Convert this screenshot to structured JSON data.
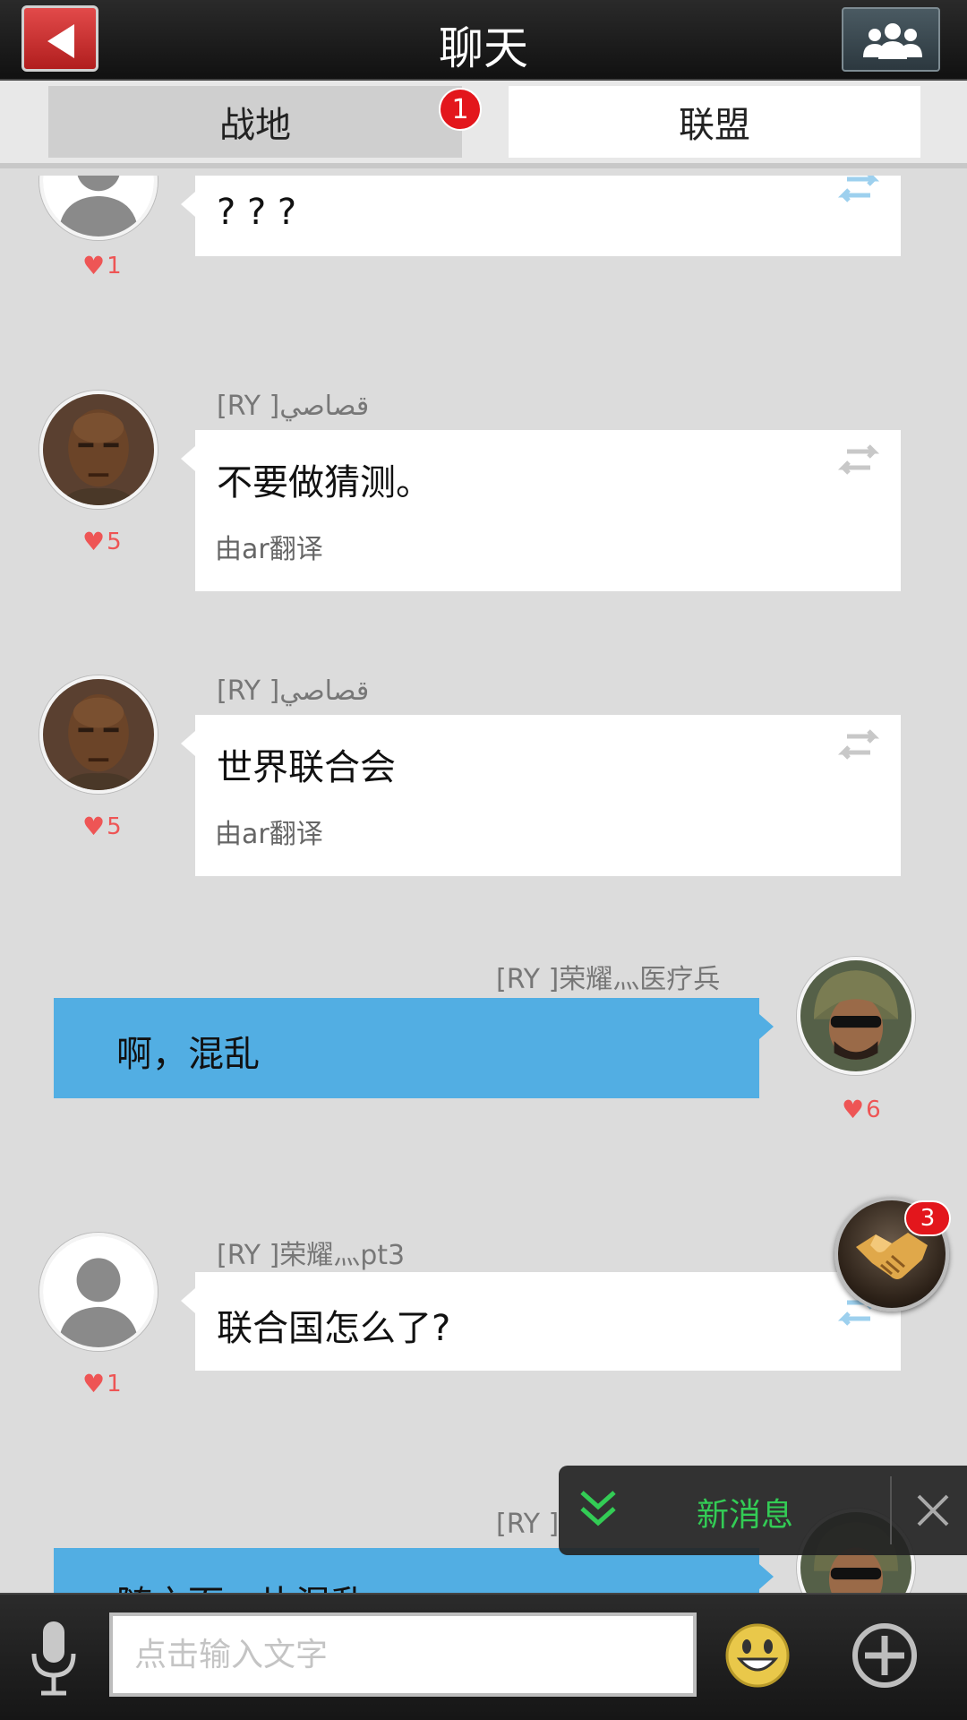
{
  "header": {
    "title": "聊天"
  },
  "tabs": [
    {
      "label": "战地",
      "badge": "1"
    },
    {
      "label": "联盟"
    }
  ],
  "messages": [
    {
      "text": "? ? ?",
      "likes": "1"
    },
    {
      "sender": "[RY ]قصاصي",
      "text": "不要做猜测。",
      "note": "由ar翻译",
      "likes": "5"
    },
    {
      "sender": "[RY ]قصاصي",
      "text": "世界联合会",
      "note": "由ar翻译",
      "likes": "5"
    },
    {
      "sender": "[RY ]荣耀灬医疗兵",
      "text": "啊，混乱",
      "likes": "6"
    },
    {
      "sender": "[RY ]荣耀灬pt3",
      "text": "联合国怎么了?",
      "likes": "1"
    },
    {
      "sender": "[RY ]",
      "text": "随之而一片混乱"
    }
  ],
  "float_button": {
    "badge": "3"
  },
  "toast": {
    "text": "新消息"
  },
  "input": {
    "placeholder": "点击输入文字"
  }
}
